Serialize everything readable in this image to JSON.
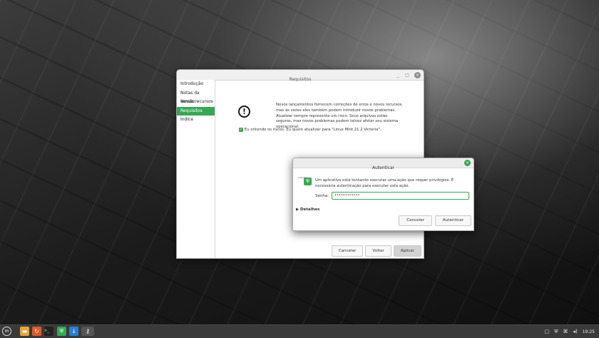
{
  "main_window": {
    "title": "Requisitos",
    "titlebar_buttons": {
      "minimize": "_",
      "maximize": "□",
      "close": "×"
    },
    "sidebar": [
      {
        "label": "Introdução",
        "active": false
      },
      {
        "label": "Notas da versão",
        "active": false
      },
      {
        "label": "Novos recursos",
        "active": false
      },
      {
        "label": "Requisitos",
        "active": true
      },
      {
        "label": "Índice",
        "active": false
      }
    ],
    "warning_icon": "!",
    "warning_text": "Novos lançamentos fornecem correções de erros e novos recursos, mas às vezes eles também podem introduzir novos problemas. Atualizar sempre representa um risco. Seus arquivos estão seguros, mas novos problemas podem talvez afetar seu sistema operacional.",
    "agree_checked": true,
    "agree_text": "Eu entendo os riscos. Eu quero atualizar para \"Linux Mint 21.2 Victoria\".",
    "buttons": {
      "cancel": "Cancelar",
      "back": "Voltar",
      "apply": "Aplicar"
    }
  },
  "auth_dialog": {
    "title": "Autenticar",
    "message": "Um aplicativo está tentando executar uma ação que requer privilégios. É necessária autenticação para executar esta ação.",
    "password_label": "Senha:",
    "password_value": "••••••••••••",
    "details_label": "Detalhes",
    "buttons": {
      "cancel": "Cancelar",
      "authenticate": "Autenticar"
    }
  },
  "panel": {
    "clock": "19:25",
    "accent_color": "#35a854"
  }
}
